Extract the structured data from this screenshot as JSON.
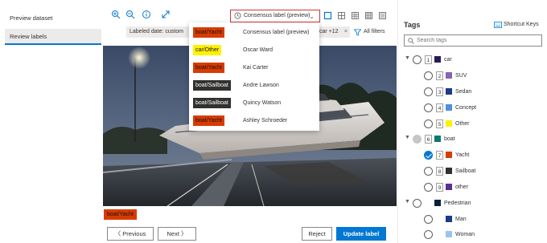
{
  "left_nav": {
    "items": [
      {
        "label": "Preview dataset"
      },
      {
        "label": "Review labels"
      }
    ]
  },
  "toolbar": {
    "icons": [
      "zoom-in-icon",
      "zoom-out-icon",
      "info-icon",
      "expand-icon"
    ],
    "consensus_label": "Consensus label (preview)",
    "view_icons": [
      "single-view-icon",
      "grid-2x2-icon",
      "grid-3x3-icon",
      "grid-4x4-icon",
      "grid-large-icon"
    ]
  },
  "filters": {
    "chip_date": "Labeled date: custom",
    "chip_tags": "car +12",
    "all_filters": "All filters"
  },
  "dropdown": {
    "items": [
      {
        "tag": "boat/Yacht",
        "name": "Consensus label (preview)",
        "color": "#d83b01"
      },
      {
        "tag": "car/Other",
        "name": "Oscar Ward",
        "color": "#fff100"
      },
      {
        "tag": "boat/Yacht",
        "name": "Kai Carter",
        "color": "#d83b01"
      },
      {
        "tag": "boat/Sailboat",
        "name": "Andre Lawson",
        "color": "#323130"
      },
      {
        "tag": "boat/Sailboat",
        "name": "Quincy Watson",
        "color": "#323130"
      },
      {
        "tag": "boat/Yacht",
        "name": "Ashley Schroeder",
        "color": "#d83b01"
      }
    ]
  },
  "image": {
    "label": "boat/Yacht",
    "label_color": "#d83b01"
  },
  "buttons": {
    "previous": "Previous",
    "next": "Next",
    "reject": "Reject",
    "update": "Update label"
  },
  "tags_panel": {
    "title": "Tags",
    "shortcut_keys": "Shortcut Keys",
    "search_placeholder": "Search tags",
    "tags": [
      {
        "num": "1",
        "label": "car",
        "color": "#2b1a5a",
        "level": 0,
        "state": "empty",
        "expand": "v"
      },
      {
        "num": "2",
        "label": "SUV",
        "color": "#8764b8",
        "level": 1,
        "state": "empty"
      },
      {
        "num": "3",
        "label": "Sedan",
        "color": "#1b3a8c",
        "level": 1,
        "state": "empty"
      },
      {
        "num": "4",
        "label": "Concept",
        "color": "#4f8fe0",
        "level": 1,
        "state": "empty"
      },
      {
        "num": "5",
        "label": "Other",
        "color": "#fff100",
        "level": 1,
        "state": "empty"
      },
      {
        "num": "6",
        "label": "boat",
        "color": "#0b7a6e",
        "level": 0,
        "state": "grey",
        "expand": "v"
      },
      {
        "num": "7",
        "label": "Yacht",
        "color": "#d83b01",
        "level": 1,
        "state": "checked"
      },
      {
        "num": "8",
        "label": "Sailboat",
        "color": "#323130",
        "level": 1,
        "state": "empty"
      },
      {
        "num": "9",
        "label": "other",
        "color": "#5c2e91",
        "level": 1,
        "state": "empty"
      },
      {
        "num": "",
        "label": "Pedestrian",
        "color": "#0b1f3a",
        "level": 0,
        "state": "empty",
        "expand": "v"
      },
      {
        "num": "",
        "label": "Man",
        "color": "#1b3a8c",
        "level": 1,
        "state": "empty"
      },
      {
        "num": "",
        "label": "Woman",
        "color": "#9cc3f0",
        "level": 1,
        "state": "empty"
      }
    ]
  },
  "colors": {
    "accent": "#0078d4",
    "highlight_border": "#d13438"
  }
}
